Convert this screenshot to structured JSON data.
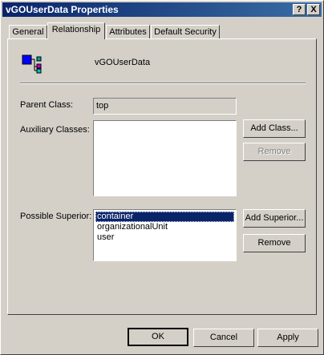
{
  "window": {
    "title": "vGOUserData Properties"
  },
  "titlebar_buttons": {
    "help": "?",
    "close": "X"
  },
  "tabs": [
    {
      "label": "General",
      "active": false
    },
    {
      "label": "Relationship",
      "active": true
    },
    {
      "label": "Attributes",
      "active": false
    },
    {
      "label": "Default Security",
      "active": false
    }
  ],
  "object": {
    "name": "vGOUserData",
    "icon": "class-icon"
  },
  "parent_class": {
    "label": "Parent Class:",
    "value": "top"
  },
  "auxiliary": {
    "label": "Auxiliary Classes:",
    "items": [],
    "add_label": "Add Class...",
    "remove_label": "Remove"
  },
  "superior": {
    "label": "Possible Superior:",
    "items": [
      "container",
      "organizationalUnit",
      "user"
    ],
    "selected": "container",
    "add_label": "Add Superior...",
    "remove_label": "Remove"
  },
  "footer": {
    "ok": "OK",
    "cancel": "Cancel",
    "apply": "Apply"
  }
}
